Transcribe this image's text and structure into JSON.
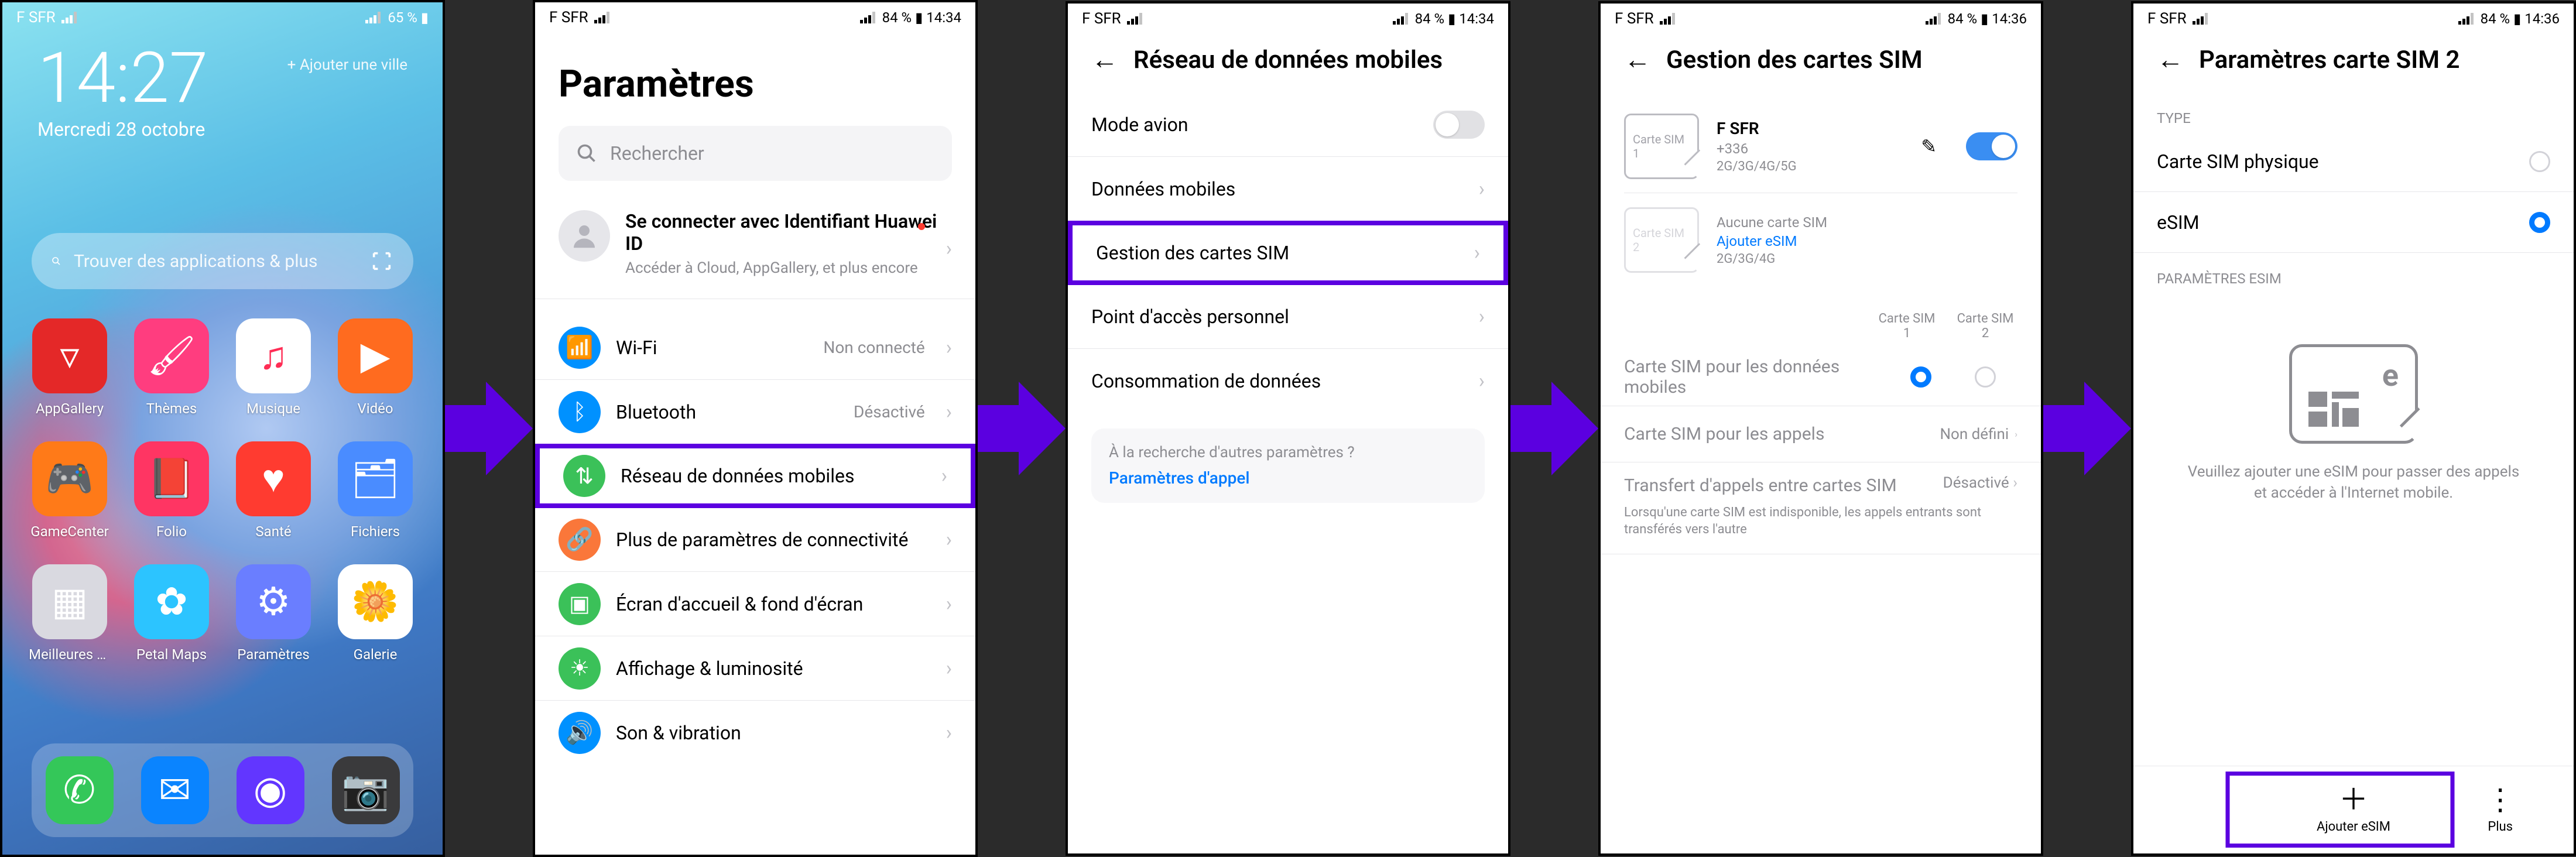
{
  "phone1": {
    "status": {
      "carrier": "F SFR",
      "right": "65 % ▮"
    },
    "clock": {
      "time": "14:27",
      "date": "Mercredi 28 octobre",
      "addcity": "Ajouter une ville"
    },
    "search_placeholder": "Trouver des applications & plus",
    "apps": [
      {
        "name": "AppGallery",
        "label": "AppGallery",
        "color": "#e42828",
        "glyph": "▿"
      },
      {
        "name": "Themes",
        "label": "Thèmes",
        "color": "#ff3d7f",
        "glyph": "🖌"
      },
      {
        "name": "Musique",
        "label": "Musique",
        "color": "#ffffff",
        "glyph": "♫",
        "fg": "#ff2d55"
      },
      {
        "name": "Video",
        "label": "Vidéo",
        "color": "#ff6b1f",
        "glyph": "▶"
      },
      {
        "name": "GameCenter",
        "label": "GameCenter",
        "color": "#ff7a18",
        "glyph": "🎮"
      },
      {
        "name": "Folio",
        "label": "Folio",
        "color": "#ff3563",
        "glyph": "📕"
      },
      {
        "name": "Sante",
        "label": "Santé",
        "color": "#ff3b30",
        "glyph": "♥"
      },
      {
        "name": "Fichiers",
        "label": "Fichiers",
        "color": "#4a8cff",
        "glyph": "🗂"
      },
      {
        "name": "MeilleuresApps",
        "label": "Meilleures ap…",
        "color": "#d9d9e0",
        "glyph": "▦"
      },
      {
        "name": "PetalMaps",
        "label": "Petal Maps",
        "color": "#2cc4ff",
        "glyph": "✿"
      },
      {
        "name": "Parametres",
        "label": "Paramètres",
        "color": "#6a7eff",
        "glyph": "⚙"
      },
      {
        "name": "Galerie",
        "label": "Galerie",
        "color": "#ffffff",
        "glyph": "🌼",
        "fg": "#ff9500"
      }
    ],
    "dock": [
      {
        "name": "Phone",
        "color": "#34c759",
        "glyph": "✆"
      },
      {
        "name": "Messages",
        "color": "#0a84ff",
        "glyph": "✉"
      },
      {
        "name": "Browser",
        "color": "#6236ff",
        "glyph": "◉"
      },
      {
        "name": "Camera",
        "color": "#3a3a3c",
        "glyph": "📷"
      }
    ]
  },
  "phone2": {
    "status": {
      "carrier": "F SFR",
      "right": "84 % ▮ 14:34"
    },
    "title": "Paramètres",
    "search_placeholder": "Rechercher",
    "account": {
      "title": "Se connecter avec Identifiant Huawei ID",
      "subtitle": "Accéder à Cloud, AppGallery, et plus encore"
    },
    "items": [
      {
        "k": "wifi",
        "label": "Wi-Fi",
        "value": "Non connecté",
        "color": "#0091ff",
        "glyph": "📶"
      },
      {
        "k": "bt",
        "label": "Bluetooth",
        "value": "Désactivé",
        "color": "#0091ff",
        "glyph": "ᛒ"
      },
      {
        "k": "data",
        "label": "Réseau de données mobiles",
        "value": "",
        "color": "#3bc159",
        "glyph": "⇅",
        "highlight": true
      },
      {
        "k": "conn",
        "label": "Plus de paramètres de connectivité",
        "value": "",
        "color": "#fa773a",
        "glyph": "🔗"
      },
      {
        "k": "home",
        "label": "Écran d'accueil & fond d'écran",
        "value": "",
        "color": "#3bc159",
        "glyph": "▣"
      },
      {
        "k": "disp",
        "label": "Affichage & luminosité",
        "value": "",
        "color": "#3bc159",
        "glyph": "☀"
      },
      {
        "k": "sound",
        "label": "Son & vibration",
        "value": "",
        "color": "#0091ff",
        "glyph": "🔊"
      }
    ]
  },
  "phone3": {
    "status": {
      "carrier": "F SFR",
      "right": "84 % ▮ 14:34"
    },
    "title": "Réseau de données mobiles",
    "rows": [
      {
        "k": "airplane",
        "label": "Mode avion",
        "type": "switch",
        "on": false
      },
      {
        "k": "mobdata",
        "label": "Données mobiles",
        "type": "chev"
      },
      {
        "k": "simmgmt",
        "label": "Gestion des cartes SIM",
        "type": "chev",
        "highlight": true
      },
      {
        "k": "hotspot",
        "label": "Point d'accès personnel",
        "type": "chev"
      },
      {
        "k": "usage",
        "label": "Consommation de données",
        "type": "chev"
      }
    ],
    "hint": {
      "q": "À la recherche d'autres paramètres ?",
      "a": "Paramètres d'appel"
    }
  },
  "phone4": {
    "status": {
      "carrier": "F SFR",
      "right": "84 % ▮ 14:36"
    },
    "title": "Gestion des cartes SIM",
    "sim1": {
      "chip": "Carte SIM 1",
      "name": "F SFR",
      "number": "+336",
      "net": "2G/3G/4G/5G",
      "on": true
    },
    "sim2": {
      "chip": "Carte SIM 2",
      "none": "Aucune carte SIM",
      "link": "Ajouter eSIM",
      "net": "2G/3G/4G"
    },
    "colhead": {
      "c1": "Carte SIM 1",
      "c2": "Carte SIM 2"
    },
    "choice": {
      "label": "Carte SIM pour les données mobiles",
      "sel": 1
    },
    "callsim": {
      "label": "Carte SIM pour les appels",
      "value": "Non défini"
    },
    "xfer": {
      "title": "Transfert d'appels entre cartes SIM",
      "desc": "Lorsqu'une carte SIM est indisponible, les appels entrants sont transférés vers l'autre",
      "value": "Désactivé"
    }
  },
  "phone5": {
    "status": {
      "carrier": "F SFR",
      "right": "84 % ▮ 14:36"
    },
    "title": "Paramètres carte SIM 2",
    "sect_type": "TYPE",
    "opt_phys": "Carte SIM physique",
    "opt_esim": "eSIM",
    "sect_esim": "PARAMÈTRES ESIM",
    "msg": "Veuillez ajouter une eSIM pour passer des appels et accéder à l'Internet mobile.",
    "btn_add": "Ajouter eSIM",
    "btn_more": "Plus"
  }
}
